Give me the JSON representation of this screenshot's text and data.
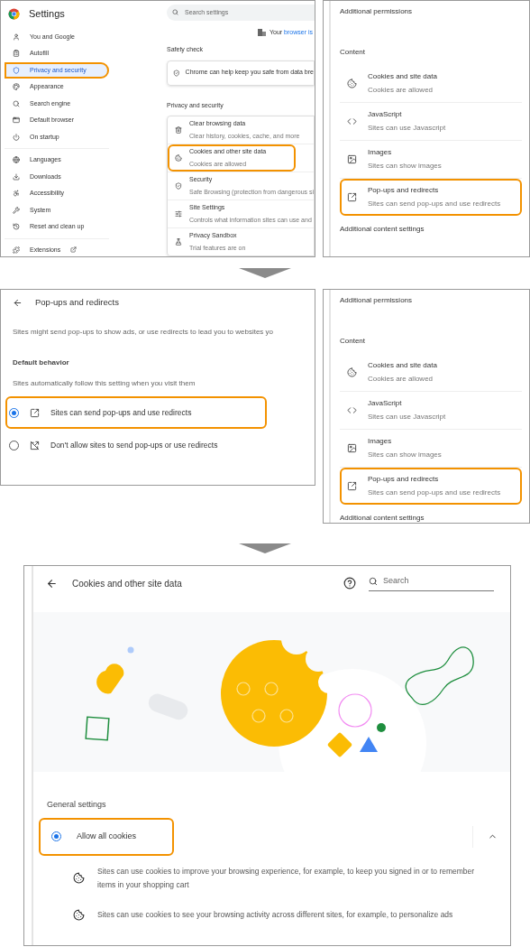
{
  "step1": {
    "settings": {
      "title": "Settings",
      "sidebar": [
        [
          {
            "label": "You and Google",
            "selected": false,
            "highlighted": false
          },
          {
            "label": "Autofill",
            "selected": false,
            "highlighted": false
          },
          {
            "label": "Privacy and security",
            "selected": true,
            "highlighted": true
          },
          {
            "label": "Appearance",
            "selected": false,
            "highlighted": false
          },
          {
            "label": "Search engine",
            "selected": false,
            "highlighted": false
          },
          {
            "label": "Default browser",
            "selected": false,
            "highlighted": false
          },
          {
            "label": "On startup",
            "selected": false,
            "highlighted": false
          }
        ],
        [
          {
            "label": "Languages",
            "selected": false,
            "highlighted": false
          },
          {
            "label": "Downloads",
            "selected": false,
            "highlighted": false
          },
          {
            "label": "Accessibility",
            "selected": false,
            "highlighted": false
          },
          {
            "label": "System",
            "selected": false,
            "highlighted": false
          },
          {
            "label": "Reset and clean up",
            "selected": false,
            "highlighted": false
          }
        ],
        [
          {
            "label": "Extensions",
            "selected": false,
            "highlighted": false,
            "external": true
          }
        ]
      ],
      "search": {
        "placeholder": "Search settings"
      },
      "managed_notice": {
        "text": "Your",
        "link": "browser is"
      },
      "safety_check": {
        "heading": "Safety check",
        "text": "Chrome can help keep you safe from data bre"
      },
      "privacy": {
        "heading": "Privacy and security",
        "items": [
          {
            "title": "Clear browsing data",
            "subtitle": "Clear history, cookies, cache, and more",
            "highlighted": false
          },
          {
            "title": "Cookies and other site data",
            "subtitle": "Cookies are allowed",
            "highlighted": true
          },
          {
            "title": "Security",
            "subtitle": "Safe Browsing (protection from dangerous si",
            "highlighted": false
          },
          {
            "title": "Site Settings",
            "subtitle": "Controls what information sites can use and",
            "highlighted": false
          },
          {
            "title": "Privacy Sandbox",
            "subtitle": "Trial features are on",
            "highlighted": false
          }
        ]
      }
    },
    "site_settings": {
      "permissions_heading": "Additional permissions",
      "content_heading": "Content",
      "items": [
        {
          "title": "Cookies and site data",
          "subtitle": "Cookies are allowed",
          "highlighted": false
        },
        {
          "title": "JavaScript",
          "subtitle": "Sites can use Javascript",
          "highlighted": false
        },
        {
          "title": "Images",
          "subtitle": "Sites can show images",
          "highlighted": false
        },
        {
          "title": "Pop-ups and redirects",
          "subtitle": "Sites can send pop-ups and use redirects",
          "highlighted": true
        }
      ],
      "footer": "Additional content settings"
    }
  },
  "step2": {
    "popups": {
      "title": "Pop-ups and redirects",
      "description": "Sites might send pop-ups to show ads, or use redirects to lead you to websites yo",
      "section": "Default behavior",
      "hint": "Sites automatically follow this setting when you visit them",
      "options": [
        {
          "label": "Sites can send pop-ups and use redirects",
          "selected": true,
          "highlighted": true
        },
        {
          "label": "Don't allow sites to send pop-ups or use redirects",
          "selected": false,
          "highlighted": false
        }
      ]
    },
    "site_settings": {
      "permissions_heading": "Additional permissions",
      "content_heading": "Content",
      "items": [
        {
          "title": "Cookies and site data",
          "subtitle": "Cookies are allowed",
          "highlighted": false
        },
        {
          "title": "JavaScript",
          "subtitle": "Sites can use Javascript",
          "highlighted": false
        },
        {
          "title": "Images",
          "subtitle": "Sites can show images",
          "highlighted": false
        },
        {
          "title": "Pop-ups and redirects",
          "subtitle": "Sites can send pop-ups and use redirects",
          "highlighted": true
        }
      ],
      "footer": "Additional content settings"
    }
  },
  "step3": {
    "cookies": {
      "title": "Cookies and other site data",
      "search": {
        "placeholder": "Search"
      },
      "section": "General settings",
      "option": {
        "label": "Allow all cookies",
        "selected": true,
        "highlighted": true,
        "expanded": true
      },
      "details": [
        "Sites can use cookies to improve your browsing experience, for example, to keep you signed in or to remember items in your shopping cart",
        "Sites can use cookies to see your browsing activity across different sites, for example, to personalize ads"
      ]
    }
  }
}
